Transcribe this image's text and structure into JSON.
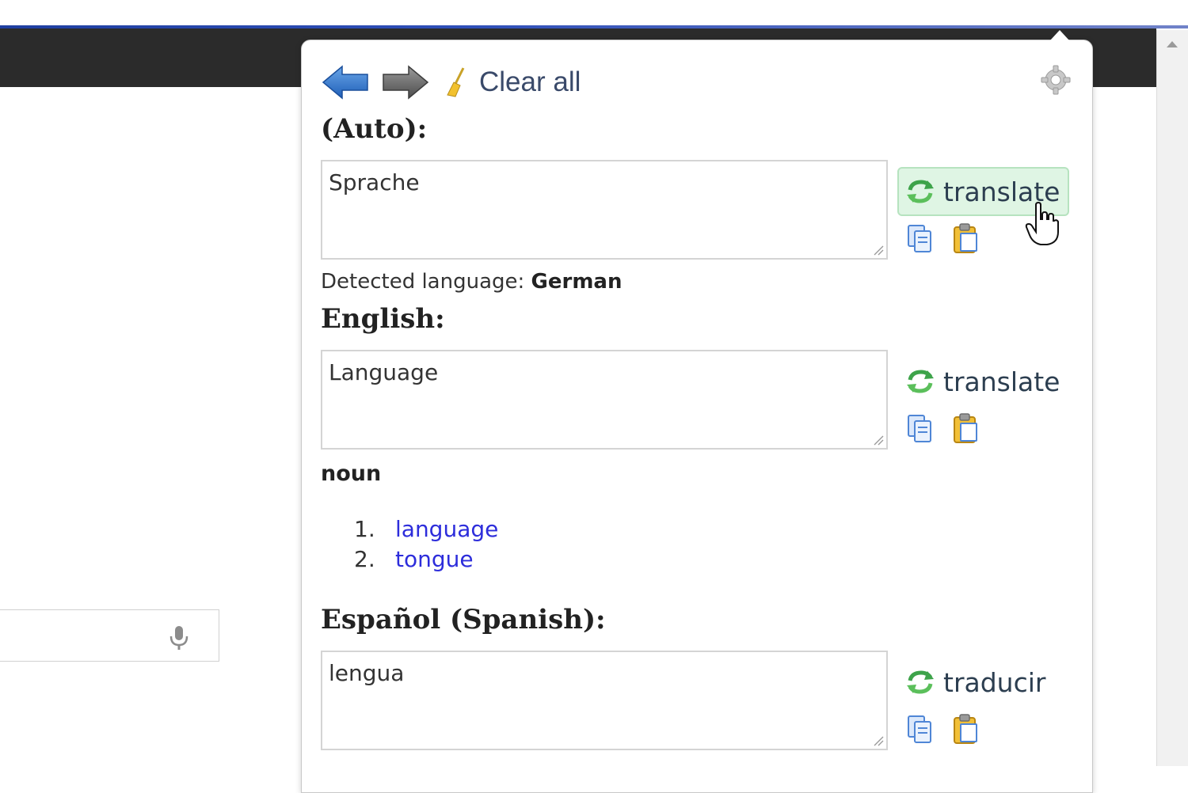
{
  "popup": {
    "toolbar": {
      "back_icon": "left-arrow-blue-icon",
      "forward_icon": "right-arrow-gray-icon",
      "clear_icon": "broom-icon",
      "clear_label": "Clear all",
      "settings_icon": "gear-icon"
    },
    "source": {
      "label": "(Auto):",
      "text": "Sprache",
      "translate_label": "translate",
      "detected_prefix": "Detected language: ",
      "detected_language": "German"
    },
    "english": {
      "label": "English:",
      "text": "Language",
      "translate_label": "translate",
      "part_of_speech": "noun",
      "definitions": [
        {
          "num": "1.",
          "word": "language"
        },
        {
          "num": "2.",
          "word": "tongue"
        }
      ]
    },
    "spanish": {
      "label": "Español (Spanish):",
      "text": "lengua",
      "translate_label": "traducir"
    }
  },
  "colors": {
    "link": "#2d2ddb",
    "translate_hover_bg": "#dff5e4",
    "browser_dark_bar": "#2b2b2b"
  }
}
